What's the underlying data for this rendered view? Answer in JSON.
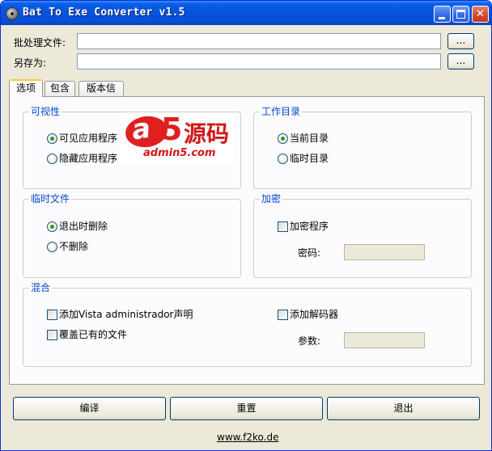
{
  "window": {
    "title": "Bat To Exe Converter v1.5"
  },
  "titlebar": {
    "min_glyph": "",
    "max_glyph": "",
    "close_glyph": "✕"
  },
  "form": {
    "batch_label": "批处理文件:",
    "batch_value": "",
    "saveas_label": "另存为:",
    "saveas_value": "",
    "browse_label": "..."
  },
  "tabs": [
    "选项",
    "包含",
    "版本信息"
  ],
  "options": {
    "visibility": {
      "title": "可视性",
      "items": [
        "可见应用程序",
        "隐藏应用程序"
      ],
      "selected": 0
    },
    "workdir": {
      "title": "工作目录",
      "items": [
        "当前目录",
        "临时目录"
      ],
      "selected": 0
    },
    "tempfiles": {
      "title": "临时文件",
      "items": [
        "退出时删除",
        "不删除"
      ],
      "selected": 0
    },
    "encrypt": {
      "title": "加密",
      "checkbox": "加密程序",
      "password_label": "密码:"
    },
    "mixed": {
      "title": "混合",
      "checks": [
        "添加Vista administrador声明",
        "覆盖已有的文件",
        "添加解码器"
      ],
      "params_label": "参数:"
    }
  },
  "watermark": {
    "mark": "a",
    "five": "5",
    "cn": "源码",
    "url": "admin5.com"
  },
  "buttons": {
    "compile": "编译",
    "reset": "重置",
    "exit": "退出"
  },
  "footer": {
    "link": "www.f2ko.de"
  }
}
